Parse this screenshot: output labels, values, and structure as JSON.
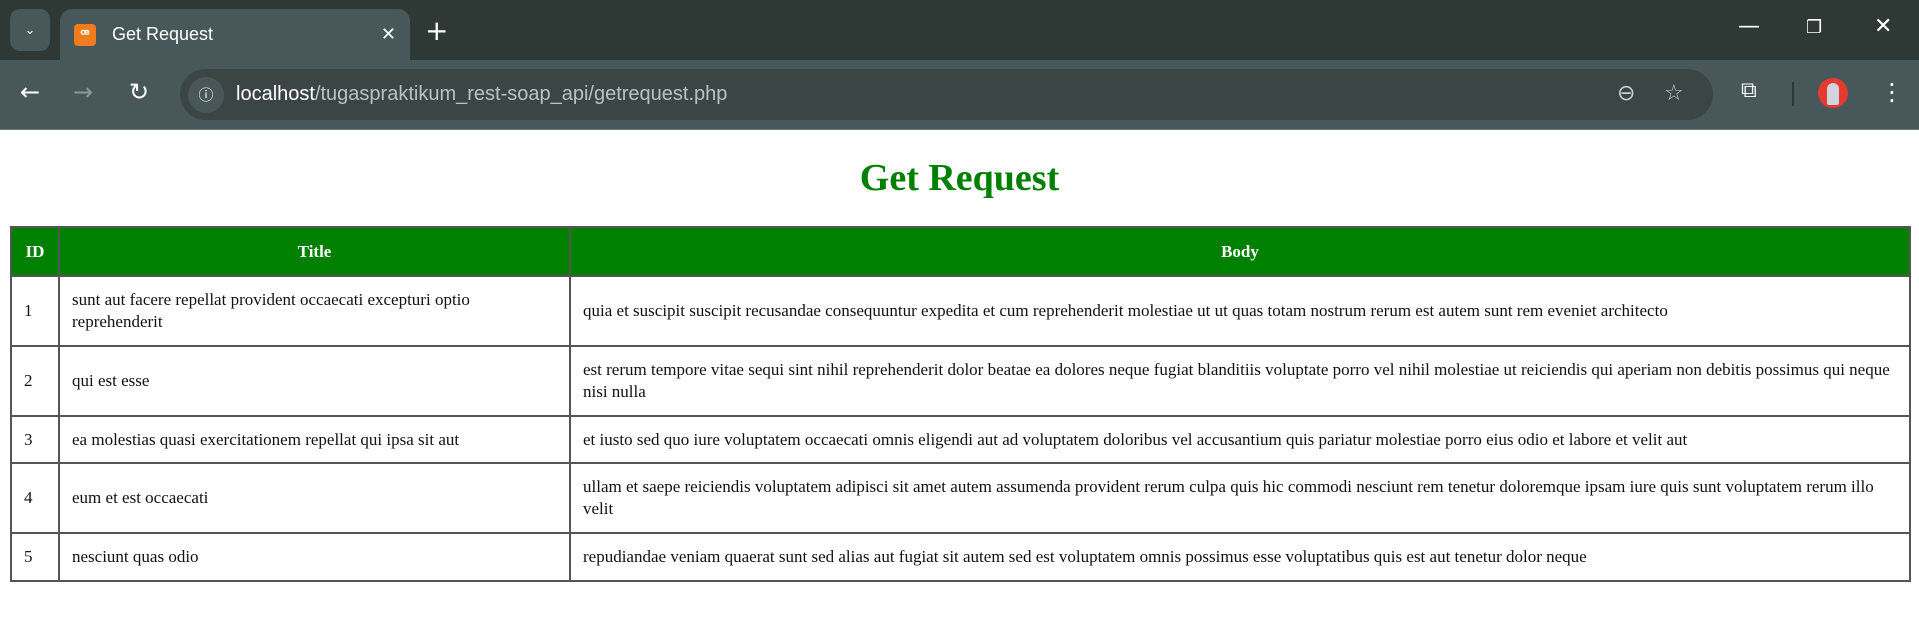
{
  "browser": {
    "tab_title": "Get Request",
    "url_host": "localhost",
    "url_path": "/tugaspraktikum_rest-soap_api/getrequest.php"
  },
  "page": {
    "heading": "Get Request",
    "accent": "#008000",
    "columns": [
      "ID",
      "Title",
      "Body"
    ],
    "rows": [
      {
        "id": "1",
        "title": "sunt aut facere repellat provident occaecati excepturi optio reprehenderit",
        "body": "quia et suscipit suscipit recusandae consequuntur expedita et cum reprehenderit molestiae ut ut quas totam nostrum rerum est autem sunt rem eveniet architecto"
      },
      {
        "id": "2",
        "title": "qui est esse",
        "body": "est rerum tempore vitae sequi sint nihil reprehenderit dolor beatae ea dolores neque fugiat blanditiis voluptate porro vel nihil molestiae ut reiciendis qui aperiam non debitis possimus qui neque nisi nulla"
      },
      {
        "id": "3",
        "title": "ea molestias quasi exercitationem repellat qui ipsa sit aut",
        "body": "et iusto sed quo iure voluptatem occaecati omnis eligendi aut ad voluptatem doloribus vel accusantium quis pariatur molestiae porro eius odio et labore et velit aut"
      },
      {
        "id": "4",
        "title": "eum et est occaecati",
        "body": "ullam et saepe reiciendis voluptatem adipisci sit amet autem assumenda provident rerum culpa quis hic commodi nesciunt rem tenetur doloremque ipsam iure quis sunt voluptatem rerum illo velit"
      },
      {
        "id": "5",
        "title": "nesciunt quas odio",
        "body": "repudiandae veniam quaerat sunt sed alias aut fugiat sit autem sed est voluptatem omnis possimus esse voluptatibus quis est aut tenetur dolor neque"
      }
    ]
  }
}
